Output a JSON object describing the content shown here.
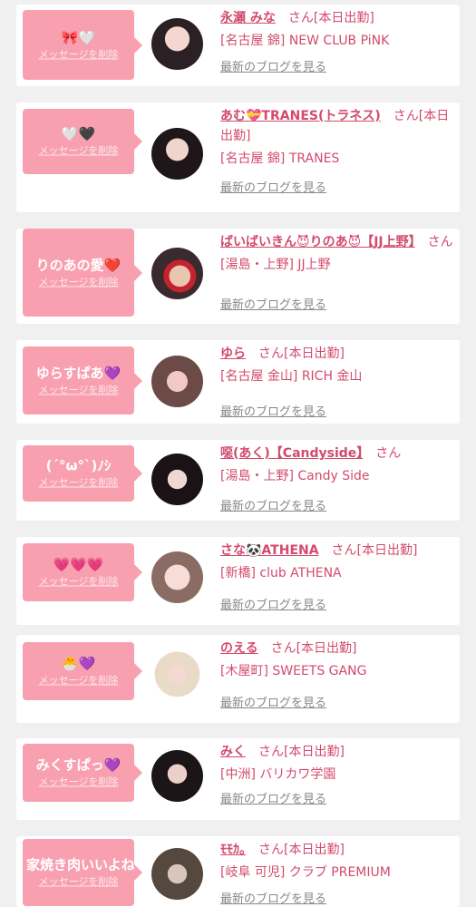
{
  "delete_label": "メッセージを削除",
  "blog_label": "最新のブログを見る",
  "entries": [
    {
      "message": "🎀🤍",
      "name": "永瀬 みな",
      "suffix": "さん[本日出勤]",
      "shop": "[名古屋 錦] NEW CLUB PiNK"
    },
    {
      "message": "🤍🖤",
      "name": "あむ💝TRANES(トラネス)",
      "suffix": "さん[本日出勤]",
      "shop": "[名古屋 錦] TRANES"
    },
    {
      "message": "りのあの愛❤️",
      "name": "ばいばいきん😈りのあ😈【JJ上野】",
      "suffix": "さん",
      "shop": "[湯島・上野] JJ上野"
    },
    {
      "message": "ゆらすぱあ💜",
      "name": "ゆら",
      "suffix": "さん[本日出勤]",
      "shop": "[名古屋 金山] RICH 金山"
    },
    {
      "message": "(´°ω°`)ﾉｼ",
      "name": "噁(あく)【Candyside】",
      "suffix": "さん",
      "shop": "[湯島・上野] Candy Side"
    },
    {
      "message": "💗💗💗",
      "name": "さな🐼ATHENA",
      "suffix": "さん[本日出勤]",
      "shop": "[新橋] club ATHENA"
    },
    {
      "message": "🐣💜",
      "name": "のえる",
      "suffix": "さん[本日出勤]",
      "shop": "[木屋町] SWEETS GANG"
    },
    {
      "message": "みくすぱっ💜",
      "name": "みく",
      "suffix": "さん[本日出勤]",
      "shop": "[中洲] バリカワ学園"
    },
    {
      "message": "家焼き肉いいよね👍🥩",
      "name": "ﾓﾓｶ。",
      "suffix": "さん[本日出勤]",
      "shop": "[岐阜 可児] クラブ PREMIUM"
    }
  ]
}
